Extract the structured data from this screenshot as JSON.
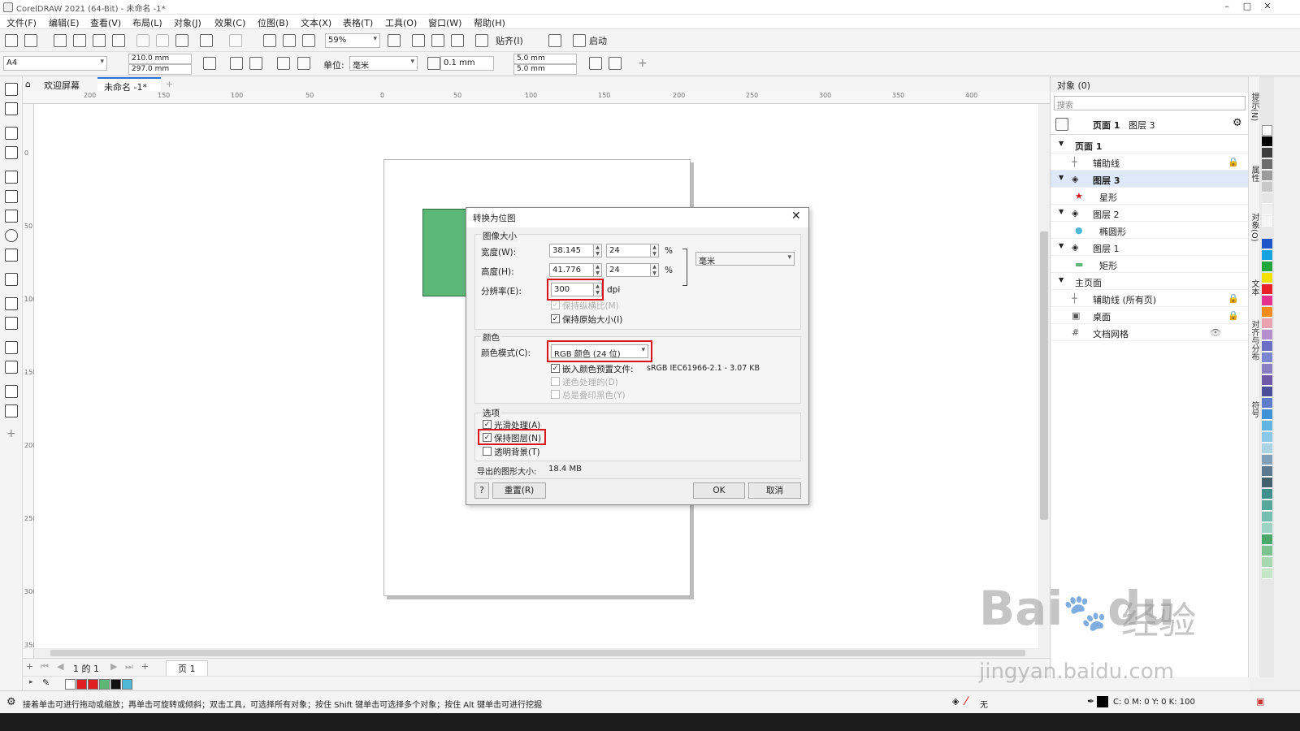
{
  "window": {
    "title": "CorelDRAW 2021 (64-Bit) - 未命名 -1*",
    "min": "–",
    "max": "□",
    "close": "✕"
  },
  "menu": [
    "文件(F)",
    "编辑(E)",
    "查看(V)",
    "布局(L)",
    "对象(J)",
    "效果(C)",
    "位图(B)",
    "文本(X)",
    "表格(T)",
    "工具(O)",
    "窗口(W)",
    "帮助(H)"
  ],
  "toolbar": {
    "zoom": "59%",
    "snap": "贴齐(I)",
    "launch": "启动"
  },
  "propbar": {
    "page_size": "A4",
    "width": "210.0 mm",
    "height": "297.0 mm",
    "unit_label": "单位:",
    "unit": "毫米",
    "nudge": "0.1 mm",
    "dup_x": "5.0 mm",
    "dup_y": "5.0 mm"
  },
  "tabs": {
    "home": "欢迎屏幕",
    "doc": "未命名 -1*",
    "add": "+"
  },
  "ruler": {
    "h": [
      "200",
      "150",
      "100",
      "50",
      "0",
      "50",
      "100",
      "150",
      "200",
      "250",
      "300",
      "350",
      "400"
    ],
    "v": [
      "0",
      "50",
      "100",
      "150",
      "200",
      "250",
      "300",
      "350"
    ]
  },
  "pagenav": {
    "count": "1 的 1",
    "page_tab": "页 1"
  },
  "docker": {
    "title": "对象 (0)",
    "search_placeholder": "搜索",
    "header_page": "页面 1",
    "header_layer": "图层 3",
    "rows": [
      {
        "label": "页面 1",
        "level": 0
      },
      {
        "label": "辅助线",
        "level": 1
      },
      {
        "label": "图层 3",
        "level": 1
      },
      {
        "label": "星形",
        "level": 2
      },
      {
        "label": "图层 2",
        "level": 1
      },
      {
        "label": "椭圆形",
        "level": 2
      },
      {
        "label": "图层 1",
        "level": 1
      },
      {
        "label": "矩形",
        "level": 2
      },
      {
        "label": "主页面",
        "level": 0
      },
      {
        "label": "辅助线 (所有页)",
        "level": 1
      },
      {
        "label": "桌面",
        "level": 1
      },
      {
        "label": "文档网格",
        "level": 1
      }
    ]
  },
  "sidetabs": [
    "提示(N)",
    "属性",
    "对象(O)",
    "文本",
    "对齐与分布",
    "符号"
  ],
  "dialog": {
    "title": "转换为位图",
    "close": "✕",
    "size_group": "图像大小",
    "width_label": "宽度(W):",
    "width_value": "38.145",
    "width_pct": "24",
    "height_label": "高度(H):",
    "height_value": "41.776",
    "height_pct": "24",
    "pct": "%",
    "unit": "毫米",
    "res_label": "分辨率(E):",
    "res_value": "300",
    "res_unit": "dpi",
    "keep_ratio": "保持纵横比(M)",
    "keep_size": "保持原始大小(I)",
    "color_group": "颜色",
    "color_mode_label": "颜色模式(C):",
    "color_mode": "RGB 颜色 (24 位)",
    "embed_profile": "嵌入颜色预置文件:",
    "profile_name": "sRGB IEC61966-2.1 - 3.07 KB",
    "dither": "递色处理的(D)",
    "overprint_black": "总是叠印黑色(Y)",
    "options_group": "选项",
    "antialias": "光滑处理(A)",
    "keep_layers": "保持图层(N)",
    "transparent_bg": "透明背景(T)",
    "export_size_label": "导出的图形大小:",
    "export_size": "18.4 MB",
    "help": "?",
    "reset": "重置(R)",
    "ok": "OK",
    "cancel": "取消"
  },
  "status": {
    "hint": "接着单击可进行拖动或缩放；再单击可旋转或倾斜；双击工具，可选择所有对象；按住 Shift 键单击可选择多个对象；按住 Alt 键单击可进行挖掘",
    "fill": "无",
    "outline": "C: 0 M: 0 Y: 0 K: 100"
  },
  "watermark": {
    "brand": "Bai",
    "brand2": "du",
    "cn": "经验",
    "url": "jingyan.baidu.com"
  },
  "colors": {
    "accent": "#2f72d6",
    "highlight": "#d9141b",
    "green_rect": "#5db878"
  }
}
